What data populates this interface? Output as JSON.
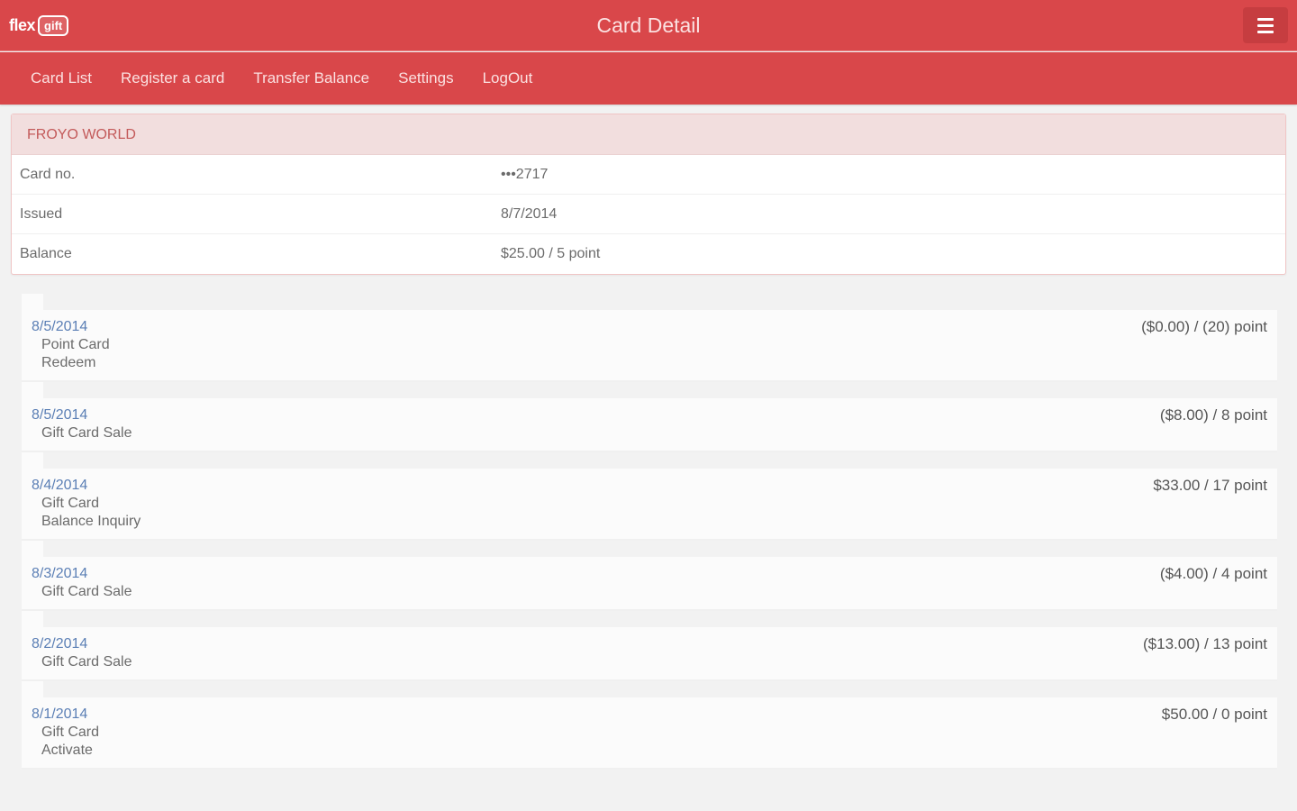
{
  "header": {
    "logo_text": "flex",
    "logo_badge": "gift",
    "title": "Card Detail"
  },
  "nav": {
    "items": [
      "Card List",
      "Register a card",
      "Transfer Balance",
      "Settings",
      "LogOut"
    ]
  },
  "card": {
    "name": "FROYO WORLD",
    "rows": [
      {
        "label": "Card no.",
        "value": "•••2717"
      },
      {
        "label": "Issued",
        "value": "8/7/2014"
      },
      {
        "label": "Balance",
        "value": "$25.00 / 5 point"
      }
    ]
  },
  "transactions": [
    {
      "date": "8/5/2014",
      "lines": [
        "Point Card",
        "Redeem"
      ],
      "amount": "($0.00) / (20) point"
    },
    {
      "date": "8/5/2014",
      "lines": [
        "Gift Card Sale"
      ],
      "amount": "($8.00) / 8 point"
    },
    {
      "date": "8/4/2014",
      "lines": [
        "Gift Card",
        "Balance Inquiry"
      ],
      "amount": "$33.00 / 17 point"
    },
    {
      "date": "8/3/2014",
      "lines": [
        "Gift Card Sale"
      ],
      "amount": "($4.00) / 4 point"
    },
    {
      "date": "8/2/2014",
      "lines": [
        "Gift Card Sale"
      ],
      "amount": "($13.00) / 13 point"
    },
    {
      "date": "8/1/2014",
      "lines": [
        "Gift Card",
        "Activate"
      ],
      "amount": "$50.00 / 0 point"
    }
  ],
  "colors": {
    "brand": "#d9474a",
    "header_bg_light": "#f2dede",
    "date_link": "#5b7fb5"
  },
  "icons": {
    "menu": "hamburger-icon"
  }
}
